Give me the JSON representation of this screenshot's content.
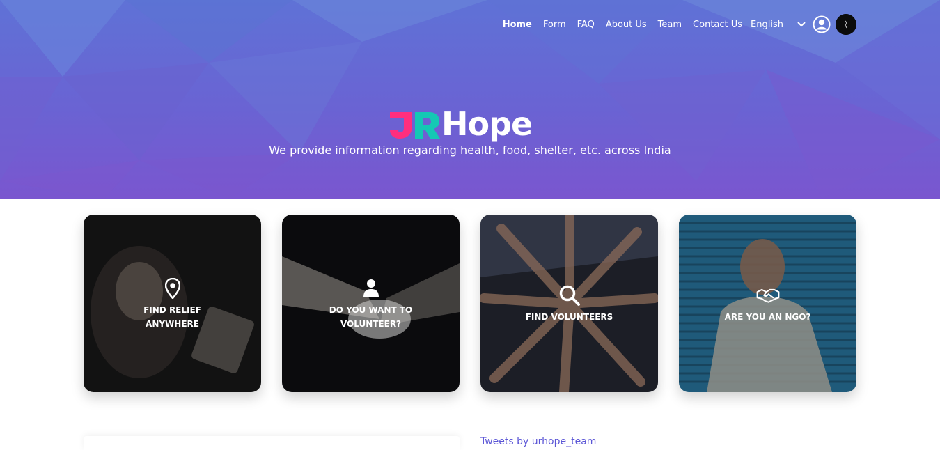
{
  "nav": {
    "items": [
      {
        "label": "Home",
        "active": true
      },
      {
        "label": "Form",
        "active": false
      },
      {
        "label": "FAQ",
        "active": false
      },
      {
        "label": "About Us",
        "active": false
      },
      {
        "label": "Team",
        "active": false
      },
      {
        "label": "Contact Us",
        "active": false
      }
    ],
    "language": {
      "selected": "English",
      "icon": "chevron-down-icon"
    },
    "user_icon": "user-circle-icon",
    "avatar_icon": "avatar"
  },
  "brand": {
    "logo_text": "Hope",
    "logo_mark_colors": {
      "u": "#ff2e7e",
      "r": "#14c8b4"
    }
  },
  "hero": {
    "tagline": "We provide information regarding health, food, shelter, etc. across India",
    "colors": {
      "top": "#5f72d6",
      "bottom": "#7a56cf"
    }
  },
  "cards": [
    {
      "label": "FIND RELIEF ANYWHERE",
      "icon": "map-pin-icon"
    },
    {
      "label": "DO YOU WANT TO VOLUNTEER?",
      "icon": "person-icon"
    },
    {
      "label": "FIND VOLUNTEERS",
      "icon": "search-icon"
    },
    {
      "label": "ARE YOU AN NGO?",
      "icon": "handshake-icon"
    }
  ],
  "tweets": {
    "label": "Tweets by urhope_team"
  }
}
